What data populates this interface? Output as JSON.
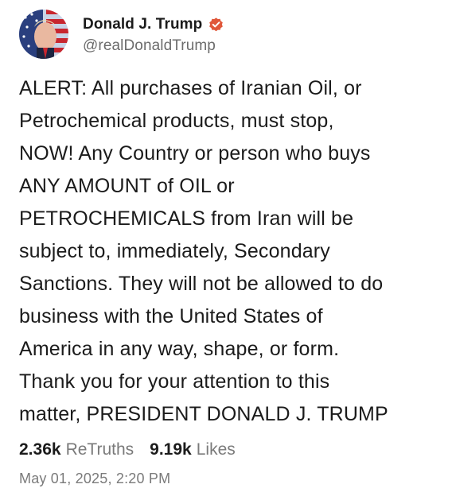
{
  "author": {
    "display_name": "Donald J. Trump",
    "handle": "@realDonaldTrump",
    "verified_icon": "verified-badge-icon",
    "verified_color": "#e0573a"
  },
  "post": {
    "lines": [
      "ALERT: All purchases of Iranian Oil, or",
      "Petrochemical products, must stop,",
      "NOW! Any Country or person who buys",
      "ANY AMOUNT of OIL or",
      "PETROCHEMICALS from Iran will be",
      "subject to, immediately, Secondary",
      "Sanctions. They will not be allowed to do",
      "business with the United States of",
      "America in any way, shape, or form.",
      "Thank you for your attention to this",
      "matter, PRESIDENT DONALD J. TRUMP"
    ]
  },
  "stats": {
    "retruths_count": "2.36k",
    "retruths_label": "ReTruths",
    "likes_count": "9.19k",
    "likes_label": "Likes"
  },
  "timestamp": "May 01, 2025, 2:20 PM"
}
